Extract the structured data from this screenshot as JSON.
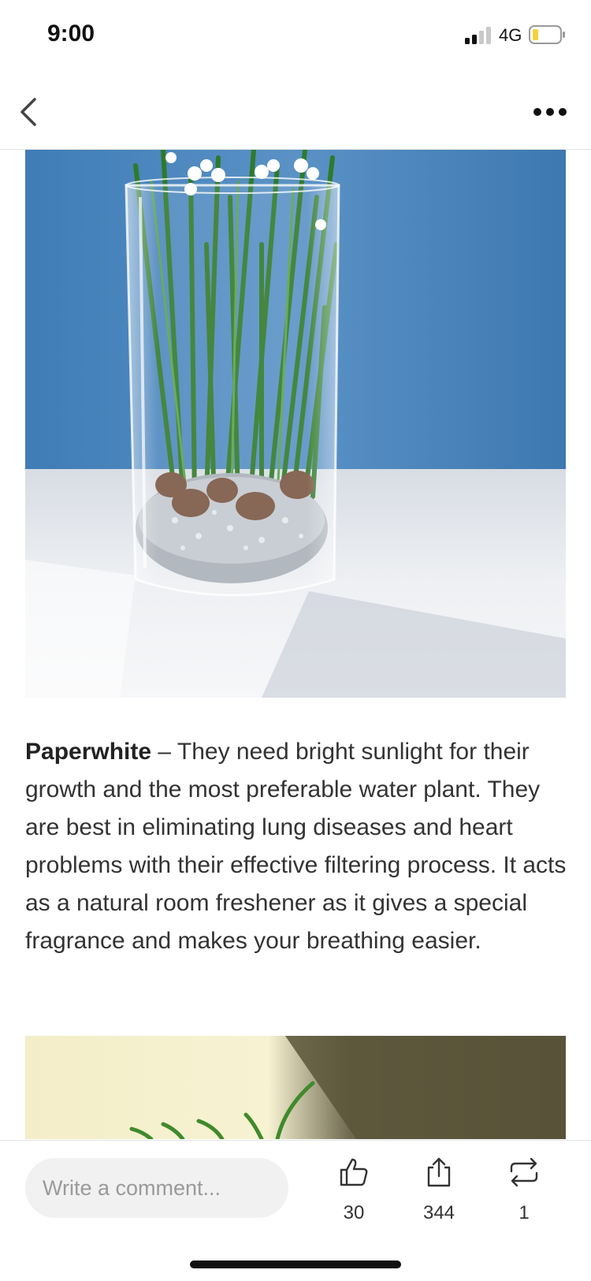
{
  "status_bar": {
    "time": "9:00",
    "network": "4G",
    "icons": [
      "signal-icon",
      "battery-icon"
    ]
  },
  "nav": {
    "icons": [
      "back-chevron-icon",
      "more-dots-icon"
    ]
  },
  "article": {
    "images": [
      "paperwhite-bulbs-in-glass-vase-photo",
      "green-plant-photo"
    ],
    "paragraph": {
      "title": "Paperwhite",
      "body": " – They need bright sunlight for their growth and the most preferable water plant. They are best in eliminating lung diseases and heart problems with their effective filtering process. It acts as a natural room freshener as it gives a special fragrance and makes your breathing easier."
    }
  },
  "bottom_bar": {
    "comment_placeholder": "Write a comment...",
    "likes": "30",
    "shares": "344",
    "reposts": "1",
    "icons": [
      "thumbs-up-icon",
      "share-icon",
      "repost-icon"
    ]
  },
  "colors": {
    "background": "#ffffff",
    "text": "#333333",
    "divider": "#e3e3e3",
    "comment_bg": "#f1f1f1",
    "wall_blue": "#4a82b8",
    "battery_low": "#f5d13a"
  }
}
